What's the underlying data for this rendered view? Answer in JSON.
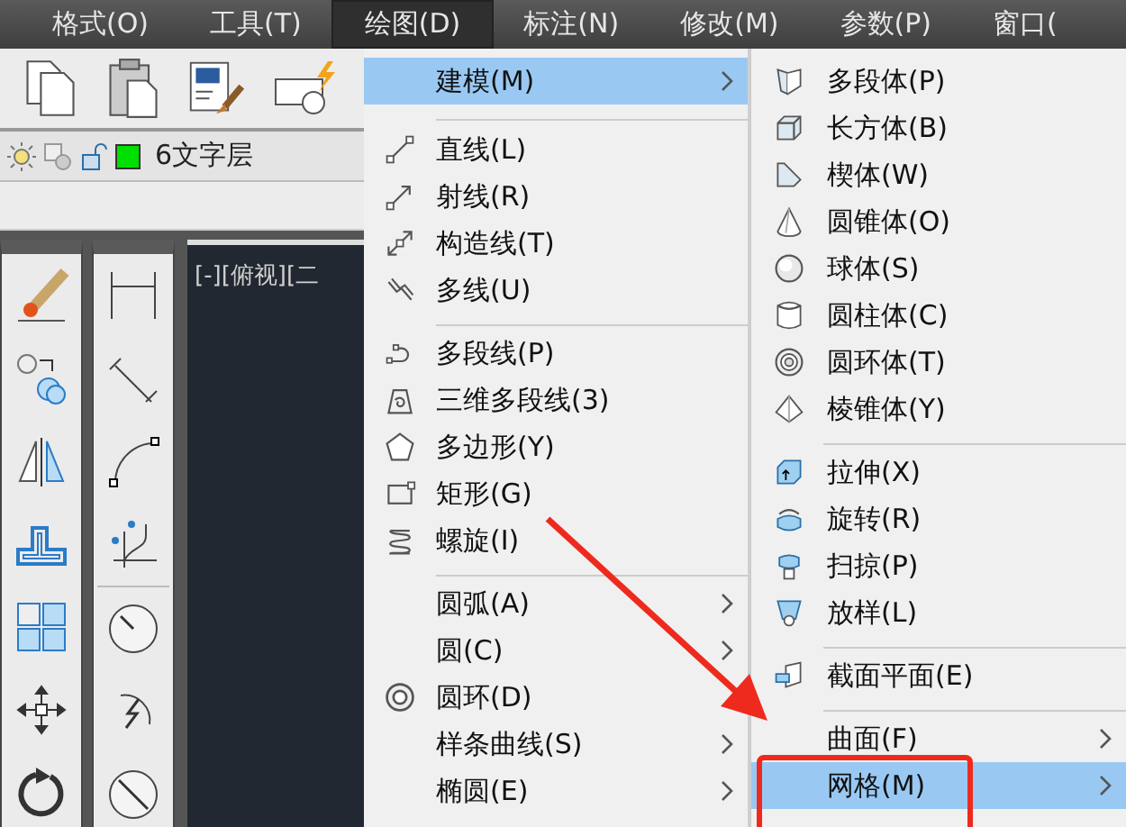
{
  "menubar": [
    {
      "label": "格式(O)",
      "selected": false
    },
    {
      "label": "工具(T)",
      "selected": false
    },
    {
      "label": "绘图(D)",
      "selected": true
    },
    {
      "label": "标注(N)",
      "selected": false
    },
    {
      "label": "修改(M)",
      "selected": false
    },
    {
      "label": "参数(P)",
      "selected": false
    },
    {
      "label": "窗口(",
      "selected": false
    }
  ],
  "layer_bar": {
    "layer_name": "6文字层"
  },
  "viewport": {
    "label": "[-][俯视][二"
  },
  "draw_menu": [
    {
      "kind": "item",
      "label": "建模(M)",
      "submenu": true,
      "selected": true
    },
    {
      "kind": "separator"
    },
    {
      "kind": "item",
      "label": "直线(L)",
      "submenu": false,
      "selected": false
    },
    {
      "kind": "item",
      "label": "射线(R)",
      "submenu": false,
      "selected": false
    },
    {
      "kind": "item",
      "label": "构造线(T)",
      "submenu": false,
      "selected": false
    },
    {
      "kind": "item",
      "label": "多线(U)",
      "submenu": false,
      "selected": false
    },
    {
      "kind": "separator"
    },
    {
      "kind": "item",
      "label": "多段线(P)",
      "submenu": false,
      "selected": false
    },
    {
      "kind": "item",
      "label": "三维多段线(3)",
      "submenu": false,
      "selected": false
    },
    {
      "kind": "item",
      "label": "多边形(Y)",
      "submenu": false,
      "selected": false
    },
    {
      "kind": "item",
      "label": "矩形(G)",
      "submenu": false,
      "selected": false
    },
    {
      "kind": "item",
      "label": "螺旋(I)",
      "submenu": false,
      "selected": false
    },
    {
      "kind": "separator"
    },
    {
      "kind": "item",
      "label": "圆弧(A)",
      "submenu": true,
      "selected": false
    },
    {
      "kind": "item",
      "label": "圆(C)",
      "submenu": true,
      "selected": false
    },
    {
      "kind": "item",
      "label": "圆环(D)",
      "submenu": false,
      "selected": false
    },
    {
      "kind": "item",
      "label": "样条曲线(S)",
      "submenu": true,
      "selected": false
    },
    {
      "kind": "item",
      "label": "椭圆(E)",
      "submenu": true,
      "selected": false
    }
  ],
  "modeling_submenu": [
    {
      "kind": "item",
      "label": "多段体(P)",
      "submenu": false,
      "selected": false
    },
    {
      "kind": "item",
      "label": "长方体(B)",
      "submenu": false,
      "selected": false
    },
    {
      "kind": "item",
      "label": "楔体(W)",
      "submenu": false,
      "selected": false
    },
    {
      "kind": "item",
      "label": "圆锥体(O)",
      "submenu": false,
      "selected": false
    },
    {
      "kind": "item",
      "label": "球体(S)",
      "submenu": false,
      "selected": false
    },
    {
      "kind": "item",
      "label": "圆柱体(C)",
      "submenu": false,
      "selected": false
    },
    {
      "kind": "item",
      "label": "圆环体(T)",
      "submenu": false,
      "selected": false
    },
    {
      "kind": "item",
      "label": "棱锥体(Y)",
      "submenu": false,
      "selected": false
    },
    {
      "kind": "separator"
    },
    {
      "kind": "item",
      "label": "拉伸(X)",
      "submenu": false,
      "selected": false
    },
    {
      "kind": "item",
      "label": "旋转(R)",
      "submenu": false,
      "selected": false
    },
    {
      "kind": "item",
      "label": "扫掠(P)",
      "submenu": false,
      "selected": false
    },
    {
      "kind": "item",
      "label": "放样(L)",
      "submenu": false,
      "selected": false
    },
    {
      "kind": "separator"
    },
    {
      "kind": "item",
      "label": "截面平面(E)",
      "submenu": false,
      "selected": false
    },
    {
      "kind": "separator"
    },
    {
      "kind": "item",
      "label": "曲面(F)",
      "submenu": true,
      "selected": false
    },
    {
      "kind": "item",
      "label": "网格(M)",
      "submenu": true,
      "selected": true
    }
  ]
}
